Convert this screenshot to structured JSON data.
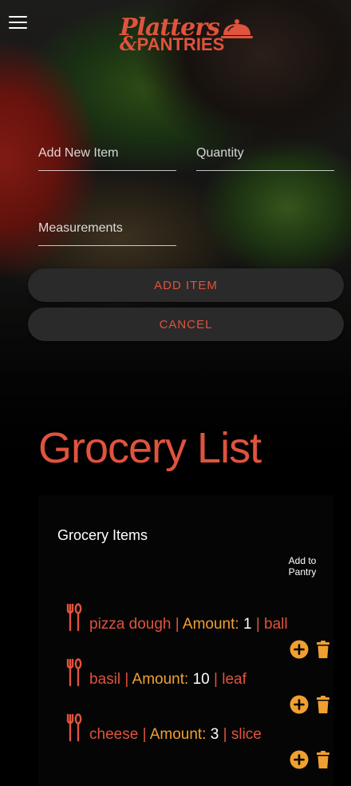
{
  "app": {
    "logo_line1": "Platters",
    "logo_amp": "&",
    "logo_line2": "PANTRIES"
  },
  "form": {
    "item_placeholder": "Add New Item",
    "quantity_placeholder": "Quantity",
    "measurements_placeholder": "Measurements",
    "add_button": "ADD ITEM",
    "cancel_button": "CANCEL"
  },
  "page": {
    "title": "Grocery List"
  },
  "list": {
    "heading": "Grocery Items",
    "add_to_pantry_header": "Add to Pantry",
    "amount_label": "Amount:",
    "separator": "|",
    "items": [
      {
        "name": "pizza dough",
        "amount": "1",
        "unit": "ball"
      },
      {
        "name": "basil",
        "amount": "10",
        "unit": "leaf"
      },
      {
        "name": "cheese",
        "amount": "3",
        "unit": "slice"
      }
    ]
  },
  "colors": {
    "accent": "#e0533d",
    "amount_label": "#f0a030",
    "action_icon": "#f0a030",
    "button_bg": "#2a2a2a"
  },
  "icons": {
    "menu": "hamburger-icon",
    "logo": "cloche-icon",
    "item": "fork-spoon-icon",
    "add": "plus-circle-icon",
    "delete": "trash-icon"
  }
}
